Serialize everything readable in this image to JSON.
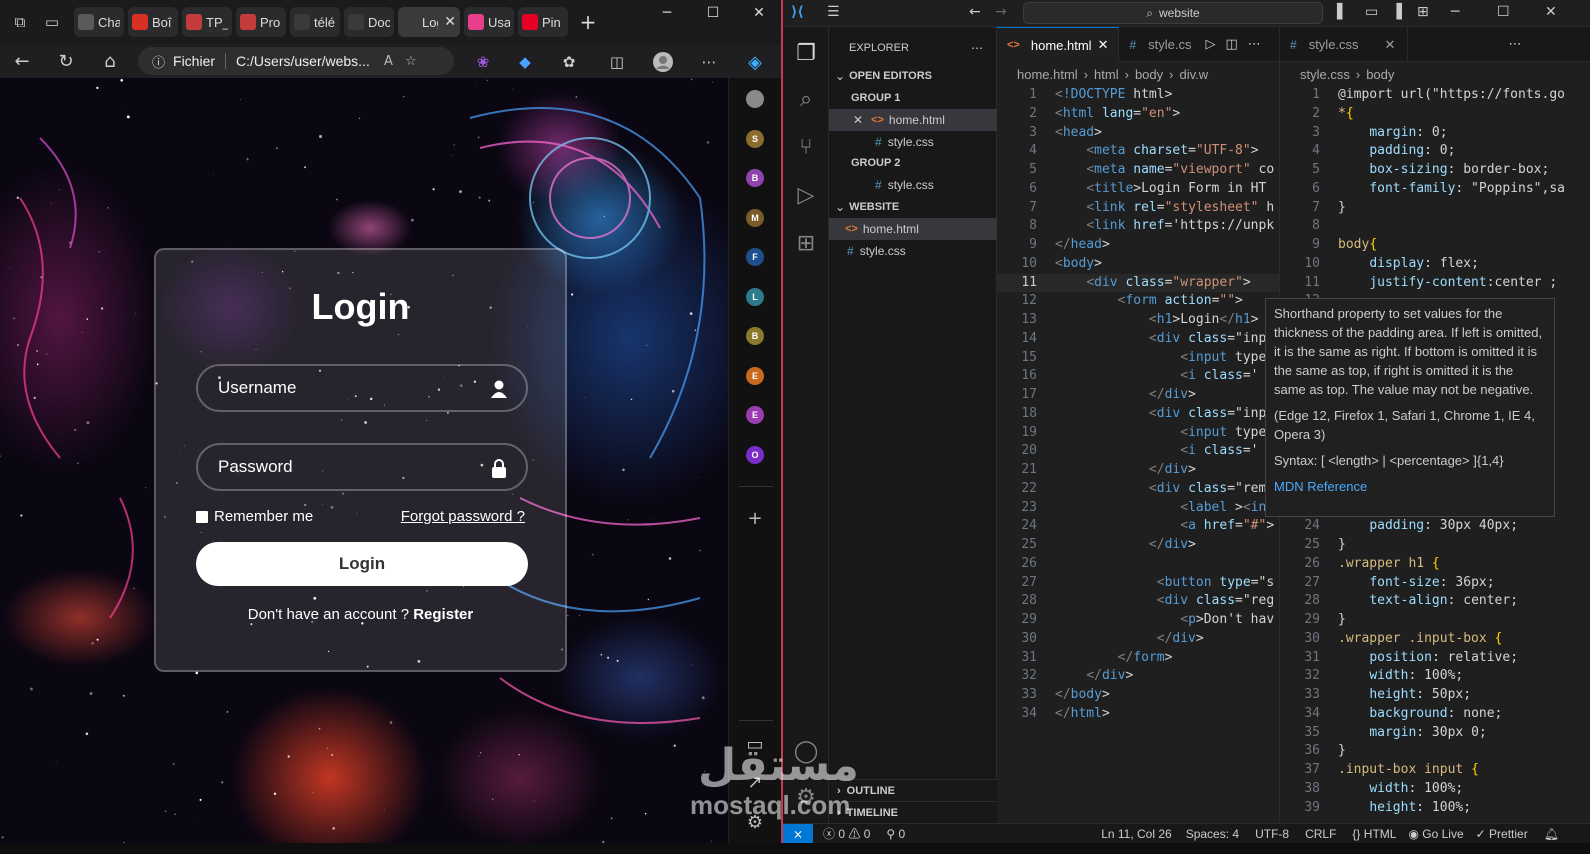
{
  "browser": {
    "tabs": [
      {
        "title": "Cha",
        "favicon": "chatgpt-icon",
        "color": "#5a5a5a"
      },
      {
        "title": "Boî",
        "favicon": "gmail-icon",
        "color": "#d93025"
      },
      {
        "title": "TP_",
        "favicon": "pdf-icon",
        "color": "#c43b3b"
      },
      {
        "title": "Pro",
        "favicon": "pdf-icon",
        "color": "#c43b3b"
      },
      {
        "title": "télé",
        "favicon": "search-icon",
        "color": "#3a3a3a"
      },
      {
        "title": "Doc",
        "favicon": "document-icon",
        "color": "#3a3a3a"
      },
      {
        "title": "Log",
        "favicon": "html-file-icon",
        "color": "#3a3a3a"
      },
      {
        "title": "Usa",
        "favicon": "colorful-icon",
        "color": "#e83e8c"
      },
      {
        "title": "Pin",
        "favicon": "pinterest-icon",
        "color": "#e60023"
      }
    ],
    "address": {
      "label": "Fichier",
      "url": "C:/Users/user/webs..."
    },
    "sidebar_avatars": [
      {
        "letter": "",
        "color": "#8a8a8a"
      },
      {
        "letter": "S",
        "color": "#8a6d2c"
      },
      {
        "letter": "B",
        "color": "#8e44ad"
      },
      {
        "letter": "M",
        "color": "#7a5a2a"
      },
      {
        "letter": "F",
        "color": "#1f4e8c"
      },
      {
        "letter": "L",
        "color": "#2c7a8c"
      },
      {
        "letter": "B",
        "color": "#8a7a2c"
      },
      {
        "letter": "E",
        "color": "#c86a1c"
      },
      {
        "letter": "E",
        "color": "#9b3cb0"
      },
      {
        "letter": "O",
        "color": "#7a2cc8"
      }
    ]
  },
  "login": {
    "title": "Login",
    "username_placeholder": "Username",
    "password_placeholder": "Password",
    "remember": "Remember me",
    "forgot": "Forgot password ?",
    "button": "Login",
    "register_text": "Don't have an account ?",
    "register_link": "Register"
  },
  "vscode": {
    "search": "website",
    "explorer_title": "EXPLORER",
    "open_editors": "OPEN EDITORS",
    "group1": "GROUP 1",
    "group2": "GROUP 2",
    "folder": "WEBSITE",
    "files": {
      "html": "home.html",
      "css": "style.css"
    },
    "outline": "OUTLINE",
    "timeline": "TIMELINE",
    "tabs": {
      "html": "home.html",
      "css_short": "style.cs",
      "css": "style.css"
    },
    "crumb_html": [
      "home.html",
      "html",
      "body",
      "div.w"
    ],
    "crumb_css": [
      "style.css",
      "body"
    ],
    "html_lines": [
      "<!DOCTYPE html>",
      "<html lang=\"en\">",
      "<head>",
      "    <meta charset=\"UTF-8\">",
      "    <meta name=\"viewport\" co",
      "    <title>Login Form in HT",
      "    <link rel=\"stylesheet\" h",
      "    <link href='https://unpk",
      "</head>",
      "<body>",
      "    <div class=\"wrapper\">",
      "        <form action=\"\">",
      "            <h1>Login</h1>",
      "            <div class=\"inp",
      "                <input type",
      "                <i class='",
      "            </div>",
      "            <div class=\"inp",
      "                <input type",
      "                <i class='",
      "            </div>",
      "            <div class=\"rem",
      "                <label ><in",
      "                <a href=\"#\">",
      "            </div>",
      "",
      "             <button type=\"s",
      "             <div class=\"reg",
      "                <p>Don't hav",
      "             </div>",
      "        </form>",
      "    </div>",
      "</body>",
      "</html>"
    ],
    "css_lines": [
      "@import url(\"https://fonts.go",
      "*{",
      "    margin: 0;",
      "    padding: 0;",
      "    box-sizing: border-box;",
      "    font-family: \"Poppins\",sa",
      "}",
      "",
      "body{",
      "    display: flex;",
      "    justify-content:center ;",
      "",
      "",
      "",
      "",
      "",
      "",
      "",
      "",
      "",
      "",
      "",
      "",
      "    padding: 30px 40px;",
      "}",
      ".wrapper h1 {",
      "    font-size: 36px;",
      "    text-align: center;",
      "}",
      ".wrapper .input-box {",
      "    position: relative;",
      "    width: 100%;",
      "    height: 50px;",
      "    background: none;",
      "    margin: 30px 0;",
      "}",
      ".input-box input {",
      "    width: 100%;",
      "    height: 100%;"
    ],
    "hover_tip": {
      "desc": "Shorthand property to set values for the thickness of the padding area. If left is omitted, it is the same as right. If bottom is omitted it is the same as top, if right is omitted it is the same as top. The value may not be negative.",
      "compat": "(Edge 12, Firefox 1, Safari 1, Chrome 1, IE 4, Opera 3)",
      "syntax": "Syntax: [ <length> | <percentage> ]{1,4}",
      "link": "MDN Reference"
    },
    "status": {
      "errors": "0",
      "warnings": "0",
      "ports": "0",
      "position": "Ln 11, Col 26",
      "spaces": "Spaces: 4",
      "encoding": "UTF-8",
      "eol": "CRLF",
      "lang": "HTML",
      "golive": "Go Live",
      "prettier": "Prettier"
    },
    "current_line": 11
  },
  "watermark": {
    "arabic": "مستقل",
    "latin": "mostaql.com"
  }
}
